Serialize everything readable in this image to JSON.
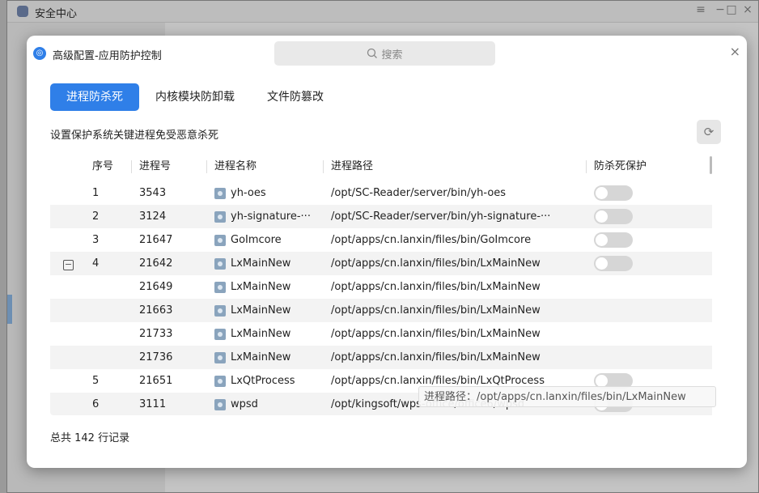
{
  "main_window": {
    "title": "安全中心",
    "controls": {
      "menu": "≡",
      "minimize": "−",
      "maximize": "□",
      "close": "×"
    }
  },
  "dialog": {
    "title": "高级配置-应用防护控制",
    "search_placeholder": "搜索",
    "close": "×",
    "tabs": [
      {
        "label": "进程防杀死",
        "active": true
      },
      {
        "label": "内核模块防卸载",
        "active": false
      },
      {
        "label": "文件防篡改",
        "active": false
      }
    ],
    "description": "设置保护系统关键进程免受恶意杀死",
    "refresh_icon": "refresh-icon",
    "table": {
      "columns": [
        "序号",
        "进程号",
        "进程名称",
        "进程路径",
        "防杀死保护"
      ],
      "rows": [
        {
          "idx": "1",
          "pid": "3543",
          "name": "yh-oes",
          "path": "/opt/SC-Reader/server/bin/yh-oes",
          "toggle": true,
          "protected": false
        },
        {
          "idx": "2",
          "pid": "3124",
          "name": "yh-signature-···",
          "path": "/opt/SC-Reader/server/bin/yh-signature-···",
          "toggle": true,
          "protected": false
        },
        {
          "idx": "3",
          "pid": "21647",
          "name": "GoImcore",
          "path": "/opt/apps/cn.lanxin/files/bin/GoImcore",
          "toggle": true,
          "protected": false
        },
        {
          "idx": "4",
          "pid": "21642",
          "name": "LxMainNew",
          "path": "/opt/apps/cn.lanxin/files/bin/LxMainNew",
          "toggle": true,
          "protected": false,
          "expanded": true
        },
        {
          "idx": "",
          "pid": "21649",
          "name": "LxMainNew",
          "path": "/opt/apps/cn.lanxin/files/bin/LxMainNew",
          "toggle": false
        },
        {
          "idx": "",
          "pid": "21663",
          "name": "LxMainNew",
          "path": "/opt/apps/cn.lanxin/files/bin/LxMainNew",
          "toggle": false
        },
        {
          "idx": "",
          "pid": "21733",
          "name": "LxMainNew",
          "path": "/opt/apps/cn.lanxin/files/bin/LxMainNew",
          "toggle": false
        },
        {
          "idx": "",
          "pid": "21736",
          "name": "LxMainNew",
          "path": "/opt/apps/cn.lanxin/files/bin/LxMainNew",
          "toggle": false
        },
        {
          "idx": "5",
          "pid": "21651",
          "name": "LxQtProcess",
          "path": "/opt/apps/cn.lanxin/files/bin/LxQtProcess",
          "toggle": true,
          "protected": false
        },
        {
          "idx": "6",
          "pid": "3111",
          "name": "wpsd",
          "path": "/opt/kingsoft/wps-office/office6/wpsd",
          "toggle": true,
          "protected": false
        }
      ]
    },
    "tooltip": "进程路径：/opt/apps/cn.lanxin/files/bin/LxMainNew",
    "footer": "总共 142 行记录"
  }
}
